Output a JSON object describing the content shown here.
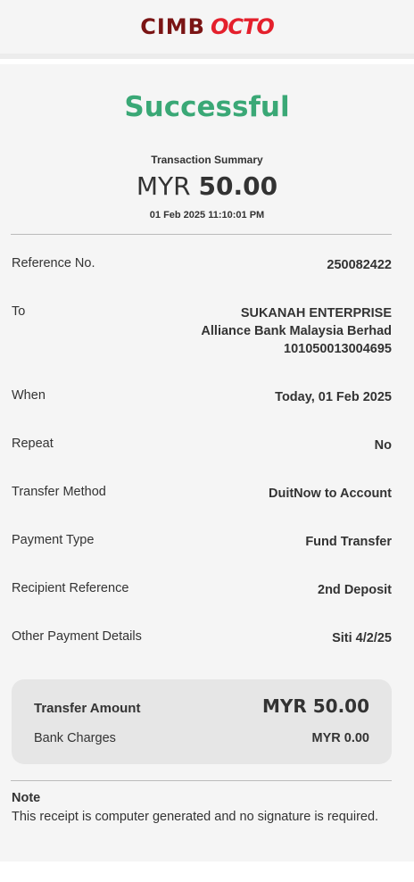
{
  "header": {
    "logo_cimb": "CIMB",
    "logo_octo": "OCTO"
  },
  "status": "Successful",
  "summary": {
    "label": "Transaction Summary",
    "currency": "MYR",
    "amount": "50.00",
    "datetime": "01 Feb 2025 11:10:01 PM"
  },
  "details": {
    "reference": {
      "label": "Reference No.",
      "value": "250082422"
    },
    "to": {
      "label": "To",
      "name": "SUKANAH ENTERPRISE",
      "bank": "Alliance Bank Malaysia Berhad",
      "account": "101050013004695"
    },
    "when": {
      "label": "When",
      "value": "Today, 01 Feb 2025"
    },
    "repeat": {
      "label": "Repeat",
      "value": "No"
    },
    "transfer_method": {
      "label": "Transfer Method",
      "value": "DuitNow to Account"
    },
    "payment_type": {
      "label": "Payment Type",
      "value": "Fund Transfer"
    },
    "recipient_reference": {
      "label": "Recipient Reference",
      "value": "2nd Deposit"
    },
    "other_details": {
      "label": "Other Payment Details",
      "value": "Siti 4/2/25"
    }
  },
  "amount_box": {
    "transfer_label": "Transfer Amount",
    "transfer_value": "MYR 50.00",
    "charges_label": "Bank Charges",
    "charges_value": "MYR 0.00"
  },
  "note": {
    "title": "Note",
    "text": "This receipt is computer generated and no signature is required."
  },
  "colors": {
    "success": "#3aa876",
    "brand_dark": "#7a1414",
    "brand_red": "#e4202c",
    "background": "#f5f5f5",
    "box": "#e6e6e6"
  }
}
